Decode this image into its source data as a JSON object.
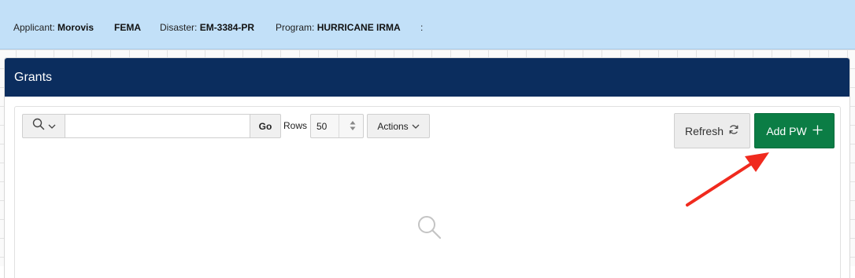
{
  "info_bar": {
    "applicant_label": "Applicant:",
    "applicant_value": "Morovis",
    "agency": "FEMA",
    "disaster_label": "Disaster:",
    "disaster_value": "EM-3384-PR",
    "program_label": "Program:",
    "program_value": "HURRICANE IRMA",
    "trailing": ":"
  },
  "region": {
    "title": "Grants"
  },
  "toolbar": {
    "search_icon": "search-icon",
    "search_value": "",
    "go_label": "Go",
    "rows_label": "Rows",
    "rows_value": "50",
    "actions_label": "Actions",
    "refresh_label": "Refresh",
    "add_label": "Add PW"
  },
  "colors": {
    "info_bar_bg": "#c2e0f8",
    "region_header_bg": "#0b2d5e",
    "add_button_bg": "#0b7d45",
    "annotation_arrow": "#f02a1e"
  }
}
